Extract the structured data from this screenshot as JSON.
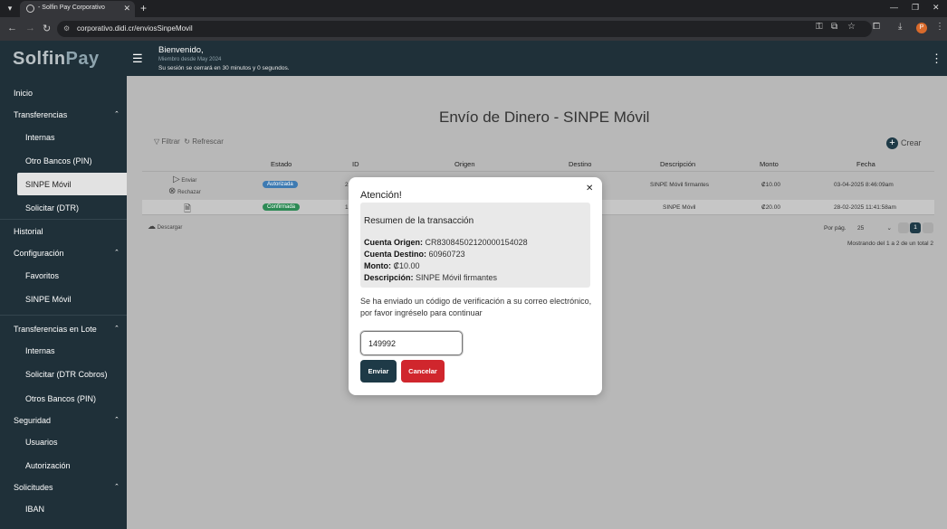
{
  "browser": {
    "tab_title": "- Solfin Pay Corporativo",
    "url": "corporativo.didi.cr/enviosSinpeMovil",
    "profile_initial": "P"
  },
  "header": {
    "brand_a": "Solfin",
    "brand_b": "Pay",
    "welcome": "Bienvenido,",
    "member_since": "Miembro desde May 2024",
    "session_notice": "Su sesión se cerrará en 30 minutos y 0 segundos."
  },
  "sidebar": {
    "inicio": "Inicio",
    "transferencias": "Transferencias",
    "internas": "Internas",
    "otro_bancos": "Otro Bancos (PIN)",
    "sinpe_movil": "SINPE Móvil",
    "solicitar_dtr": "Solicitar (DTR)",
    "historial": "Historial",
    "configuracion": "Configuración",
    "favoritos": "Favoritos",
    "config_sinpe": "SINPE Móvil",
    "lote": "Transferencias en Lote",
    "lote_internas": "Internas",
    "lote_solicitar": "Solicitar (DTR Cobros)",
    "lote_otros": "Otros Bancos (PIN)",
    "seguridad": "Seguridad",
    "usuarios": "Usuarios",
    "autorizacion": "Autorización",
    "solicitudes": "Solicitudes",
    "iban": "IBAN"
  },
  "main": {
    "title": "Envío de Dinero - SINPE Móvil",
    "filtrar": "Filtrar",
    "refrescar": "Refrescar",
    "crear": "Crear",
    "columns": {
      "estado": "Estado",
      "id": "ID",
      "origen": "Origen",
      "destino": "Destino",
      "descripcion": "Descripción",
      "monto": "Monto",
      "fecha": "Fecha"
    },
    "actions": {
      "enviar": "Enviar",
      "rechazar": "Rechazar",
      "descargar": "Descargar"
    },
    "rows": [
      {
        "estado": "Autorizada",
        "id": "2",
        "descripcion": "SINPE Móvil firmantes",
        "monto": "₡10.00",
        "fecha": "03-04-2025 8:46:09am"
      },
      {
        "estado": "Confirmada",
        "id": "1",
        "descripcion": "SINPE Móvil",
        "monto": "₡20.00",
        "fecha": "28-02-2025 11:41:58am"
      }
    ],
    "per_page_label": "Por pág.",
    "per_page": "25",
    "page": "1",
    "showing": "Mostrando del 1 a 2 de un total 2"
  },
  "modal": {
    "title": "Atención!",
    "summary_title": "Resumen de la transacción",
    "origen_label": "Cuenta Origen:",
    "origen_value": "CR83084502120000154028",
    "destino_label": "Cuenta Destino:",
    "destino_value": "60960723",
    "monto_label": "Monto:",
    "monto_value": "₡10.00",
    "desc_label": "Descripción:",
    "desc_value": "SINPE Móvil firmantes",
    "message": "Se ha enviado un código de verificación a su correo electrónico, por favor ingréselo para continuar",
    "code_value": "149992",
    "enviar": "Enviar",
    "cancelar": "Cancelar"
  },
  "colors": {
    "sidebar": "#1f3039",
    "badge_autorizada": "#3d7ab2",
    "badge_confirmada": "#2d8a55",
    "btn_enviar": "#1e3a47",
    "btn_cancelar": "#d0262d"
  }
}
